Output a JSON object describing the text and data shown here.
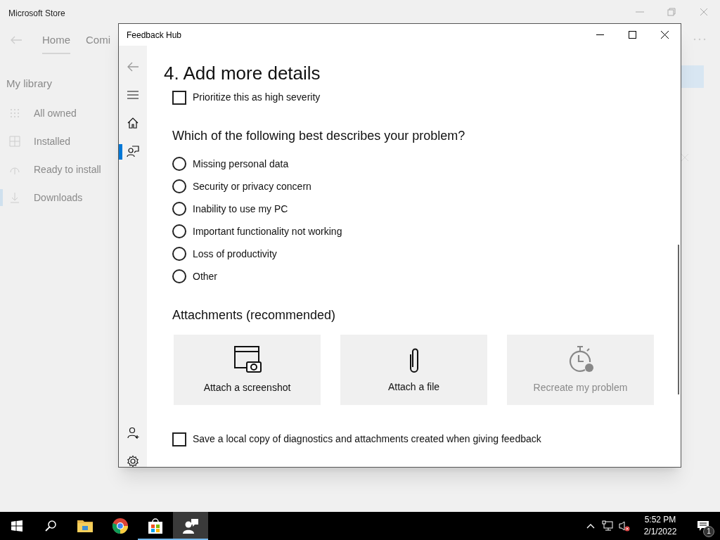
{
  "store": {
    "title": "Microsoft Store",
    "tabs": [
      {
        "label": "Home",
        "selected": true
      },
      {
        "label": "Comi",
        "selected": false
      }
    ],
    "library_heading": "My library",
    "library_items": [
      {
        "kind": "grid",
        "label": "All owned",
        "selected": false
      },
      {
        "kind": "installed",
        "label": "Installed",
        "selected": false
      },
      {
        "kind": "ready",
        "label": "Ready to install",
        "selected": false
      },
      {
        "kind": "download",
        "label": "Downloads",
        "selected": true
      }
    ]
  },
  "window": {
    "title": "Feedback Hub"
  },
  "nav": {
    "top": [
      {
        "kind": "back"
      },
      {
        "kind": "menu"
      }
    ],
    "pages": [
      {
        "kind": "home",
        "selected": false
      },
      {
        "kind": "feedback",
        "selected": true
      }
    ],
    "bottom": [
      {
        "kind": "account"
      },
      {
        "kind": "settings"
      }
    ]
  },
  "content": {
    "heading": "4. Add more details",
    "severity": {
      "label": "Prioritize this as high severity",
      "checked": false
    },
    "question": "Which of the following best describes your problem?",
    "options": [
      {
        "label": "Missing personal data",
        "selected": false
      },
      {
        "label": "Security or privacy concern",
        "selected": false
      },
      {
        "label": "Inability to use my PC",
        "selected": false
      },
      {
        "label": "Important functionality not working",
        "selected": false
      },
      {
        "label": "Loss of productivity",
        "selected": false
      },
      {
        "label": "Other",
        "selected": false
      }
    ],
    "attachments_heading": "Attachments (recommended)",
    "attachments": [
      {
        "kind": "screenshot",
        "label": "Attach a screenshot",
        "disabled": false
      },
      {
        "kind": "file",
        "label": "Attach a file",
        "disabled": false
      },
      {
        "kind": "recreate",
        "label": "Recreate my problem",
        "disabled": true
      }
    ],
    "local_copy": {
      "label": "Save a local copy of diagnostics and attachments created when giving feedback",
      "checked": false
    }
  },
  "taskbar": {
    "apps": [
      {
        "kind": "explorer",
        "running": false,
        "selected": false
      },
      {
        "kind": "chrome",
        "running": false,
        "selected": false
      },
      {
        "kind": "store",
        "running": true,
        "selected": false
      },
      {
        "kind": "feedback",
        "running": true,
        "selected": true
      }
    ],
    "time": "5:52 PM",
    "date": "2/1/2022",
    "notifications": "1"
  }
}
